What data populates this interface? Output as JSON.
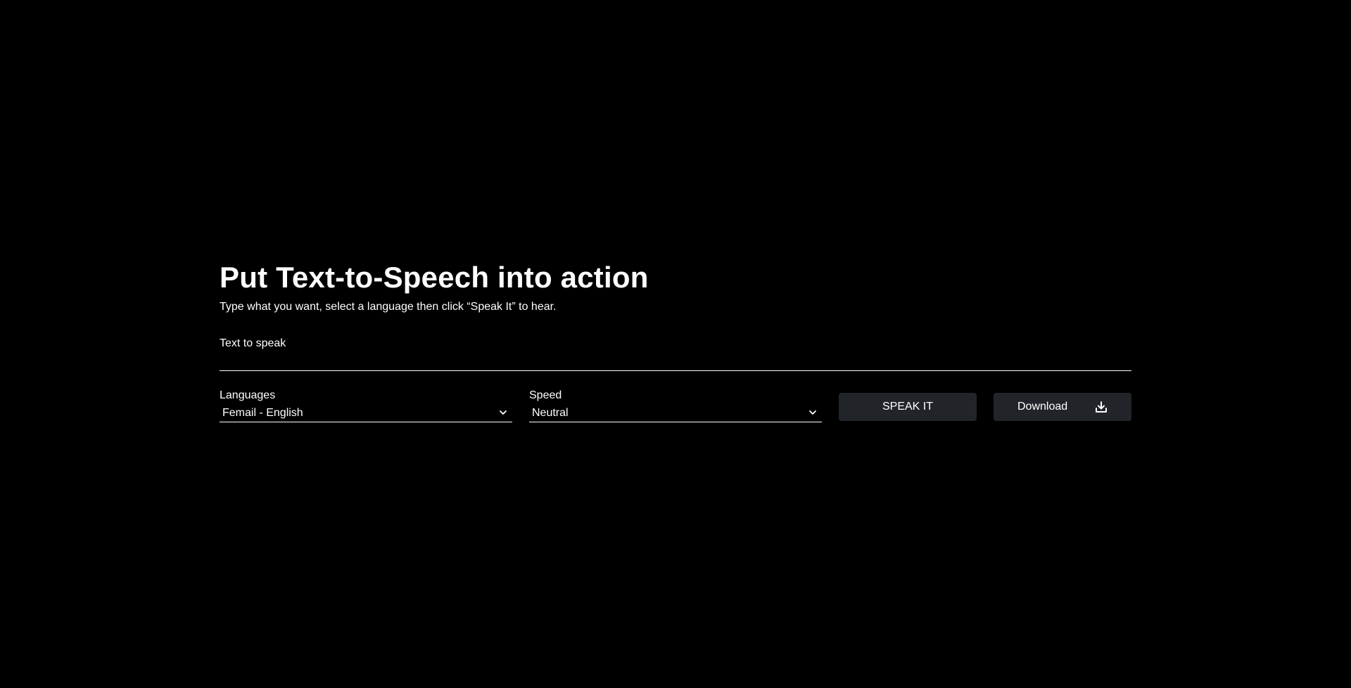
{
  "hero": {
    "title": "Put Text-to-Speech into action",
    "subtitle": "Type what you want, select a language then click “Speak It” to hear."
  },
  "text_field": {
    "label": "Text to speak",
    "value": ""
  },
  "languages": {
    "label": "Languages",
    "selected": "Femail - English"
  },
  "speed": {
    "label": "Speed",
    "selected": "Neutral"
  },
  "buttons": {
    "speak_label": "SPEAK IT",
    "download_label": "Download"
  },
  "icons": {
    "chevron": "chevron-down-icon",
    "download": "download-icon"
  },
  "colors": {
    "background": "#000000",
    "button": "#212529",
    "text": "#ffffff"
  }
}
